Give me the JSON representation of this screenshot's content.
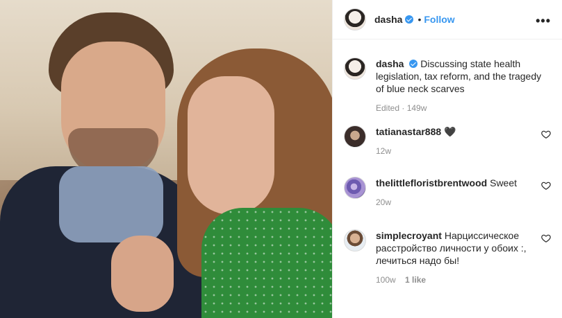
{
  "header": {
    "username": "dasha",
    "follow_label": "Follow",
    "more_label": "•••"
  },
  "caption": {
    "username": "dasha",
    "text": "Discussing state health legislation, tax reform, and the tragedy of blue neck scarves",
    "meta": "Edited · 149w"
  },
  "comments": [
    {
      "username": "tatianastar888",
      "text": "🖤",
      "age": "12w",
      "likes": ""
    },
    {
      "username": "thelittlefloristbrentwood",
      "text": "Sweet",
      "age": "20w",
      "likes": ""
    },
    {
      "username": "simplecroyant",
      "text": "Нарциссическое расстройство личности у обоих :, лечиться надо бы!",
      "age": "100w",
      "likes": "1 like"
    }
  ],
  "icons": {
    "verified": "verified-badge-icon",
    "heart": "heart-outline-icon",
    "more": "more-options-icon"
  },
  "colors": {
    "link": "#3897f0",
    "text": "#262626",
    "muted": "#8e8e8e"
  }
}
